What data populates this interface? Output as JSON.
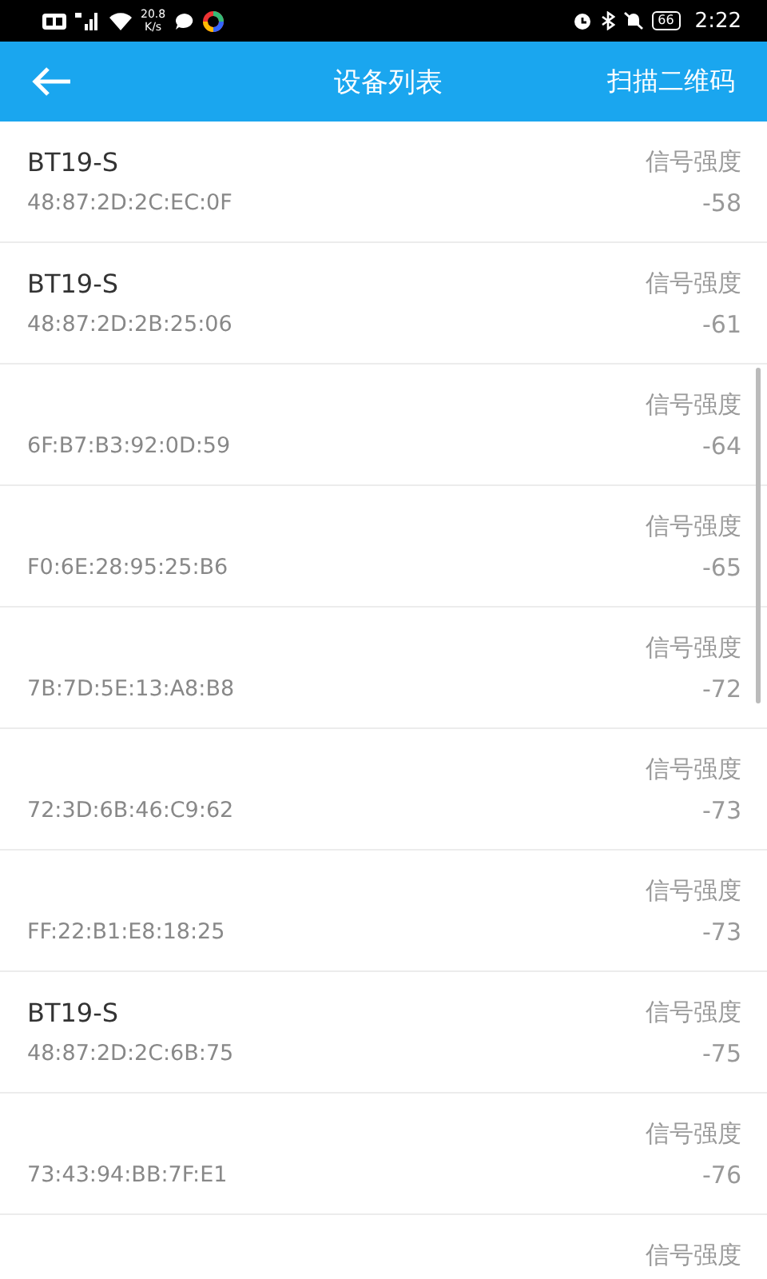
{
  "status_bar": {
    "net_speed": "20.8",
    "net_unit": "K/s",
    "battery": "66",
    "time": "2:22"
  },
  "app_bar": {
    "title": "设备列表",
    "action": "扫描二维码"
  },
  "devices": [
    {
      "name": "BT19-S",
      "mac": "48:87:2D:2C:EC:0F",
      "signal_label": "信号强度",
      "rssi": "-58"
    },
    {
      "name": "BT19-S",
      "mac": "48:87:2D:2B:25:06",
      "signal_label": "信号强度",
      "rssi": "-61"
    },
    {
      "mac": "6F:B7:B3:92:0D:59",
      "signal_label": "信号强度",
      "rssi": "-64"
    },
    {
      "mac": "F0:6E:28:95:25:B6",
      "signal_label": "信号强度",
      "rssi": "-65"
    },
    {
      "mac": "7B:7D:5E:13:A8:B8",
      "signal_label": "信号强度",
      "rssi": "-72"
    },
    {
      "mac": "72:3D:6B:46:C9:62",
      "signal_label": "信号强度",
      "rssi": "-73"
    },
    {
      "mac": "FF:22:B1:E8:18:25",
      "signal_label": "信号强度",
      "rssi": "-73"
    },
    {
      "name": "BT19-S",
      "mac": "48:87:2D:2C:6B:75",
      "signal_label": "信号强度",
      "rssi": "-75"
    },
    {
      "mac": "73:43:94:BB:7F:E1",
      "signal_label": "信号强度",
      "rssi": "-76"
    },
    {
      "signal_label": "信号强度"
    }
  ]
}
